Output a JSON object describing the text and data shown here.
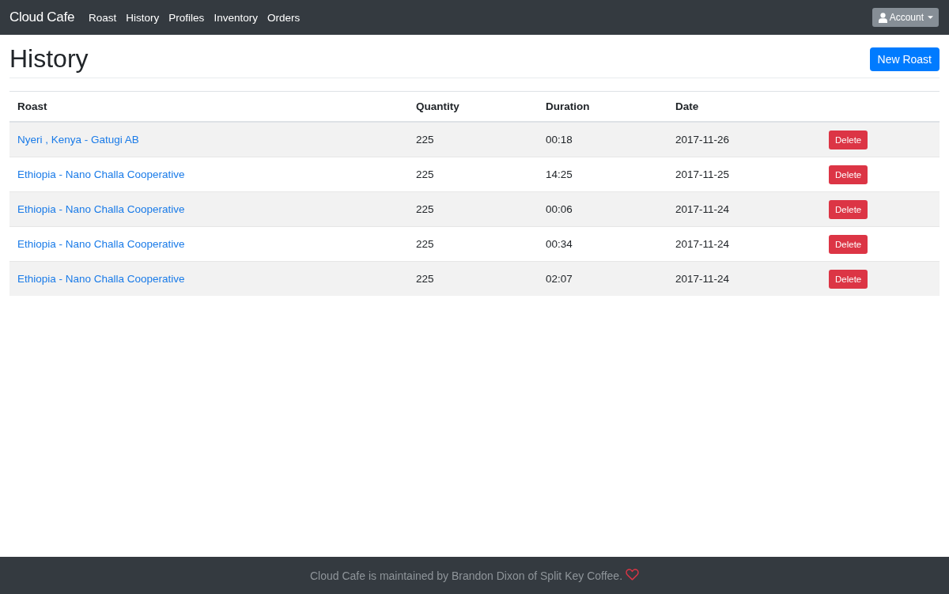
{
  "navbar": {
    "brand": "Cloud Cafe",
    "links": [
      "Roast",
      "History",
      "Profiles",
      "Inventory",
      "Orders"
    ],
    "account_button": "Account"
  },
  "page": {
    "title": "History",
    "new_button": "New Roast"
  },
  "table": {
    "columns": [
      "Roast",
      "Quantity",
      "Duration",
      "Date"
    ],
    "rows": [
      {
        "roast": "Nyeri , Kenya - Gatugi AB",
        "quantity": "225",
        "duration": "00:18",
        "date": "2017-11-26",
        "action": "Delete"
      },
      {
        "roast": "Ethiopia - Nano Challa Cooperative",
        "quantity": "225",
        "duration": "14:25",
        "date": "2017-11-25",
        "action": "Delete"
      },
      {
        "roast": "Ethiopia - Nano Challa Cooperative",
        "quantity": "225",
        "duration": "00:06",
        "date": "2017-11-24",
        "action": "Delete"
      },
      {
        "roast": "Ethiopia - Nano Challa Cooperative",
        "quantity": "225",
        "duration": "00:34",
        "date": "2017-11-24",
        "action": "Delete"
      },
      {
        "roast": "Ethiopia - Nano Challa Cooperative",
        "quantity": "225",
        "duration": "02:07",
        "date": "2017-11-24",
        "action": "Delete"
      }
    ]
  },
  "footer": {
    "text": "Cloud Cafe is maintained by Brandon Dixon of Split Key Coffee."
  }
}
